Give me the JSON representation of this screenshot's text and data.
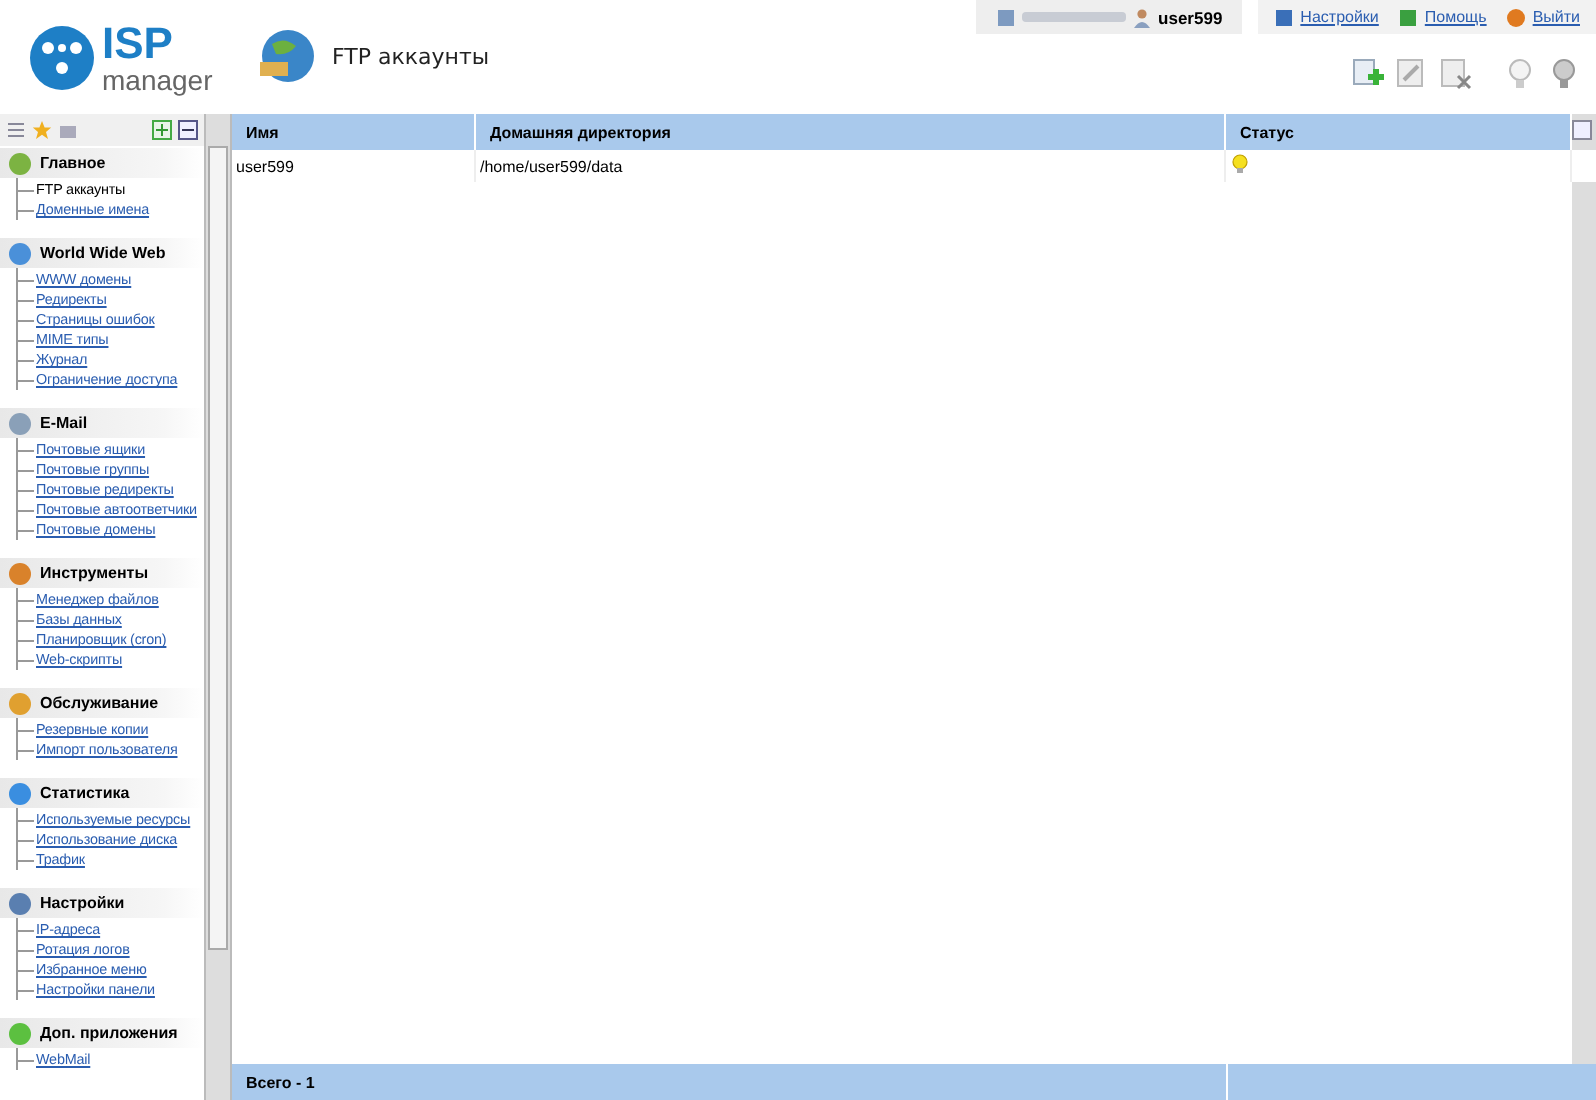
{
  "logo": {
    "line1": "ISP",
    "line2": "manager"
  },
  "page": {
    "title": "FTP аккаунты"
  },
  "user_bar": {
    "username": "user599"
  },
  "top_links": [
    {
      "label": "Настройки",
      "kind": "settings"
    },
    {
      "label": "Помощь",
      "kind": "help"
    },
    {
      "label": "Выйти",
      "kind": "logout"
    }
  ],
  "sidebar": {
    "sections": [
      {
        "title": "Главное",
        "kind": "main",
        "items": [
          {
            "label": "FTP аккаунты",
            "selected": true
          },
          {
            "label": "Доменные имена",
            "selected": false
          }
        ]
      },
      {
        "title": "World Wide Web",
        "kind": "www",
        "items": [
          {
            "label": "WWW домены",
            "selected": false
          },
          {
            "label": "Редиректы",
            "selected": false
          },
          {
            "label": "Страницы ошибок",
            "selected": false
          },
          {
            "label": "MIME типы",
            "selected": false
          },
          {
            "label": "Журнал",
            "selected": false
          },
          {
            "label": "Ограничение доступа",
            "selected": false
          }
        ]
      },
      {
        "title": "E-Mail",
        "kind": "mail",
        "items": [
          {
            "label": "Почтовые ящики",
            "selected": false
          },
          {
            "label": "Почтовые группы",
            "selected": false
          },
          {
            "label": "Почтовые редиректы",
            "selected": false
          },
          {
            "label": "Почтовые автоответчики",
            "selected": false
          },
          {
            "label": "Почтовые домены",
            "selected": false
          }
        ]
      },
      {
        "title": "Инструменты",
        "kind": "tools",
        "items": [
          {
            "label": "Менеджер файлов",
            "selected": false
          },
          {
            "label": "Базы данных",
            "selected": false
          },
          {
            "label": "Планировщик (cron)",
            "selected": false
          },
          {
            "label": "Web-скрипты",
            "selected": false
          }
        ]
      },
      {
        "title": "Обслуживание",
        "kind": "service",
        "items": [
          {
            "label": "Резервные копии",
            "selected": false
          },
          {
            "label": "Импорт пользователя",
            "selected": false
          }
        ]
      },
      {
        "title": "Статистика",
        "kind": "stats",
        "items": [
          {
            "label": "Используемые ресурсы",
            "selected": false
          },
          {
            "label": "Использование диска",
            "selected": false
          },
          {
            "label": "Трафик",
            "selected": false
          }
        ]
      },
      {
        "title": "Настройки",
        "kind": "settings",
        "items": [
          {
            "label": "IP-адреса",
            "selected": false
          },
          {
            "label": "Ротация логов",
            "selected": false
          },
          {
            "label": "Избранное меню",
            "selected": false
          },
          {
            "label": "Настройки панели",
            "selected": false
          }
        ]
      },
      {
        "title": "Доп. приложения",
        "kind": "apps",
        "items": [
          {
            "label": "WebMail",
            "selected": false
          }
        ]
      }
    ]
  },
  "table": {
    "columns": [
      "Имя",
      "Домашняя директория",
      "Статус"
    ],
    "rows": [
      {
        "name": "user599",
        "home": "/home/user599/data",
        "active": true
      }
    ],
    "footer": "Всего - 1"
  }
}
